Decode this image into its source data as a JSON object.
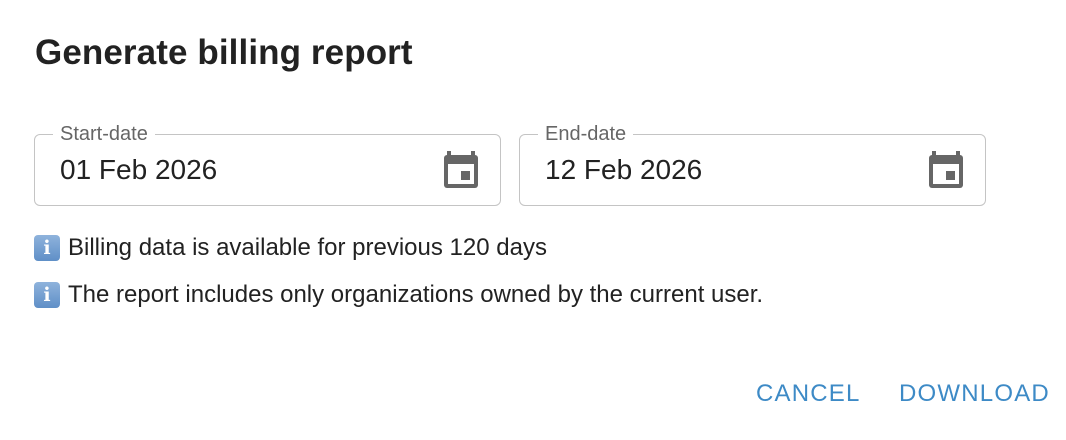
{
  "dialog": {
    "title": "Generate billing report"
  },
  "start_date": {
    "label": "Start-date",
    "value": "01 Feb 2026",
    "icon": "calendar-icon"
  },
  "end_date": {
    "label": "End-date",
    "value": "12 Feb 2026",
    "icon": "calendar-icon"
  },
  "info": [
    {
      "icon": "info-icon",
      "text": "Billing data is available for previous 120 days"
    },
    {
      "icon": "info-icon",
      "text": "The report includes only organizations owned by the current user."
    }
  ],
  "actions": {
    "cancel_label": "CANCEL",
    "download_label": "DOWNLOAD"
  },
  "colors": {
    "accent": "#3d8ac6",
    "border": "#c4c4c4",
    "icon": "#666666"
  }
}
